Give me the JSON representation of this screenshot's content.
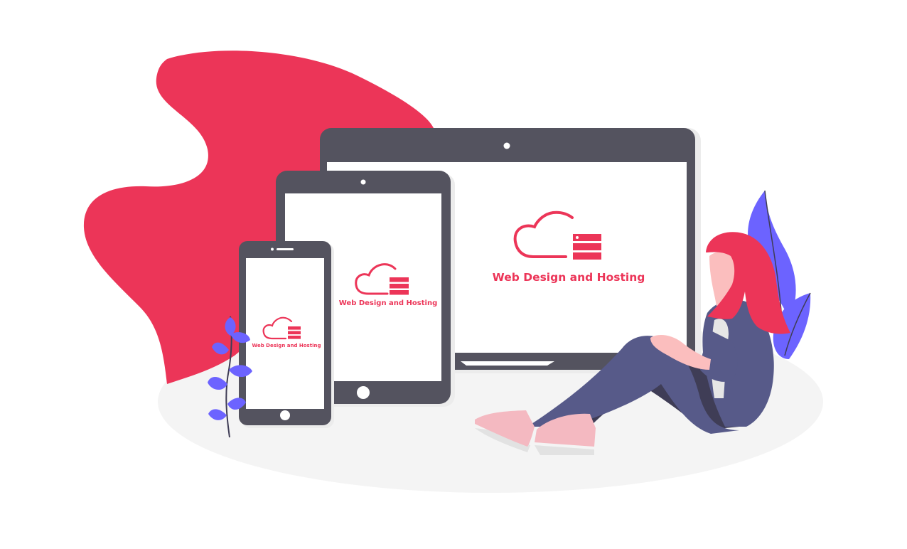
{
  "brand": {
    "name": "Web Design and Hosting",
    "logo_icon": "cloud-server-icon"
  },
  "colors": {
    "accent": "#EC3558",
    "device_frame": "#54535F",
    "screen": "#FFFFFF",
    "floor": "#F4F4F4",
    "plant": "#6C63FF",
    "jacket": "#575A89",
    "pants": "#3F3D56",
    "skin": "#FBBEBE",
    "shoes": "#F4B9C1"
  },
  "illustration": {
    "devices": [
      "laptop",
      "tablet",
      "phone"
    ],
    "elements": [
      "red-blob",
      "floor-shadow",
      "left-plant",
      "right-plant",
      "sitting-woman"
    ]
  }
}
